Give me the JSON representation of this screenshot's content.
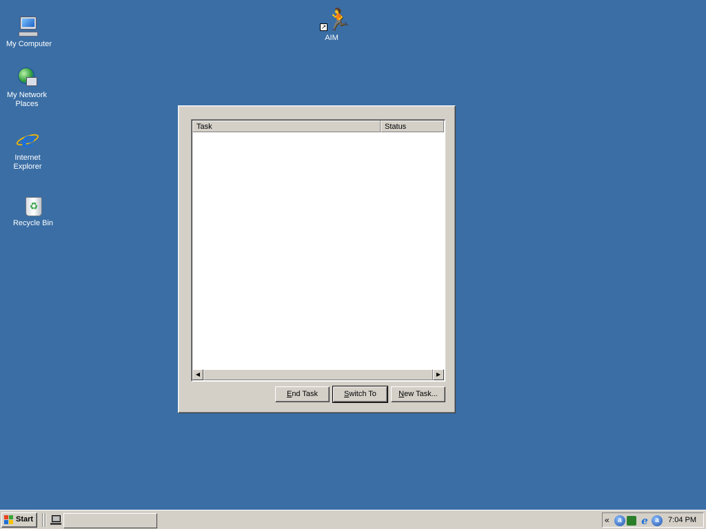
{
  "desktop": {
    "icons": [
      {
        "label": "My Computer",
        "icon": "my-computer-icon"
      },
      {
        "label": "My Network Places",
        "icon": "network-places-icon"
      },
      {
        "label": "Internet Explorer",
        "icon": "internet-explorer-icon"
      },
      {
        "label": "Recycle Bin",
        "icon": "recycle-bin-icon"
      },
      {
        "label": "AIM",
        "icon": "aim-running-man-icon"
      }
    ],
    "background_color": "#3a6ea5"
  },
  "task_manager": {
    "columns": [
      "Task",
      "Status"
    ],
    "rows": [],
    "buttons": {
      "end_task": {
        "accel": "E",
        "rest": "nd Task"
      },
      "switch_to": {
        "accel": "S",
        "rest": "witch To"
      },
      "new_task": {
        "accel": "N",
        "rest": "ew Task..."
      }
    },
    "scroll_left_glyph": "◀",
    "scroll_right_glyph": "▶"
  },
  "taskbar": {
    "start_label": "Start",
    "tray_chevron": "«",
    "clock": "7:04 PM",
    "tray_icons": [
      "aim-tray-icon",
      "network-tray-icon",
      "ie-tray-icon",
      "aim-tray-icon"
    ]
  }
}
